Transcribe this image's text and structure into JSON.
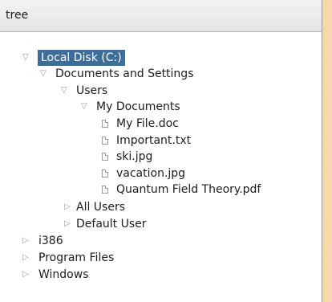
{
  "panel": {
    "title": "tree"
  },
  "tree": {
    "root": "Local Disk (C:)",
    "documents_and_settings": "Documents and Settings",
    "users": "Users",
    "my_documents": "My Documents",
    "files": [
      "My File.doc",
      "Important.txt",
      "ski.jpg",
      "vacation.jpg",
      "Quantum Field Theory.pdf"
    ],
    "all_users": "All Users",
    "default_user": "Default User",
    "i386": "i386",
    "program_files": "Program Files",
    "windows": "Windows"
  },
  "icons": {
    "expanded": "triangle-down-icon",
    "collapsed": "triangle-right-icon",
    "file": "file-icon"
  },
  "colors": {
    "selection": "#3c6e99",
    "page_background": "#f5d8a6"
  }
}
